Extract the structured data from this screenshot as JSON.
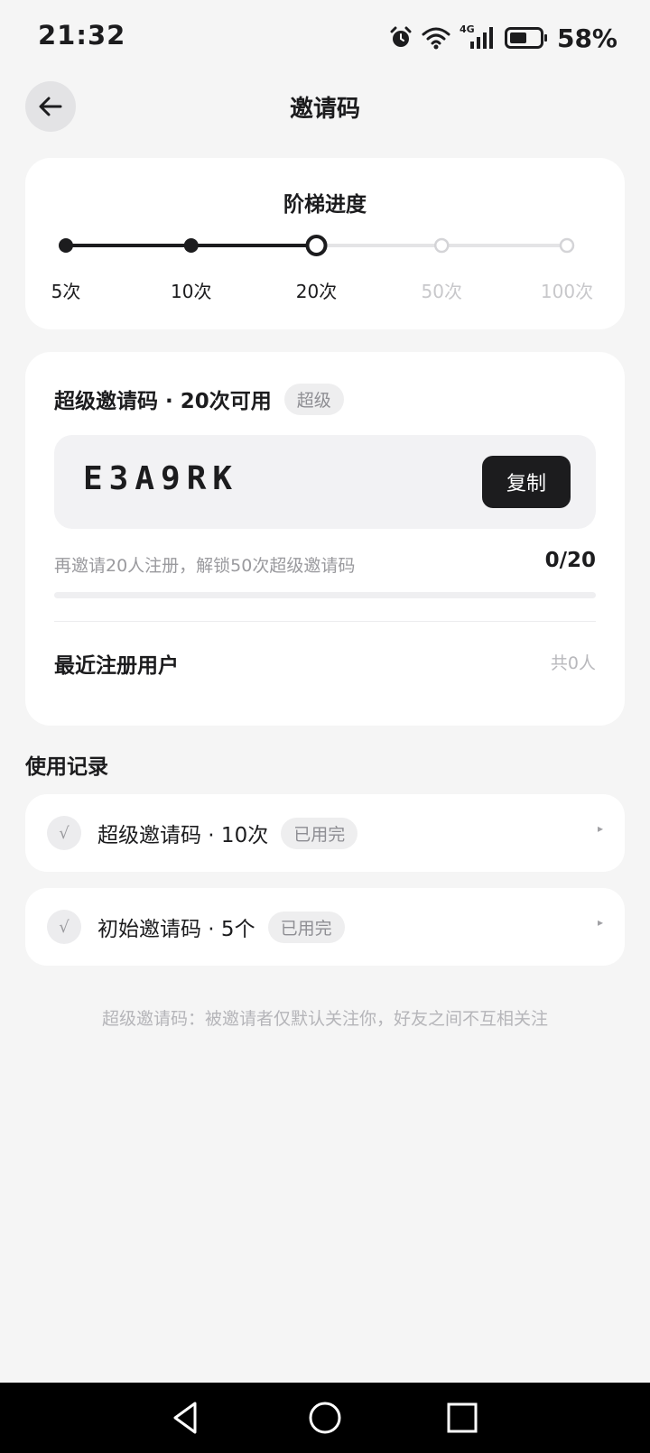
{
  "status_bar": {
    "time": "21:32",
    "network": "4G",
    "battery_percent": "58%",
    "battery_level": 0.58
  },
  "header": {
    "title": "邀请码",
    "back_icon": "arrow-left-icon"
  },
  "ladder": {
    "title": "阶梯进度",
    "steps": [
      {
        "label": "5次",
        "state": "done"
      },
      {
        "label": "10次",
        "state": "done"
      },
      {
        "label": "20次",
        "state": "current"
      },
      {
        "label": "50次",
        "state": "todo"
      },
      {
        "label": "100次",
        "state": "todo"
      }
    ]
  },
  "code_card": {
    "title": "超级邀请码 · 20次可用",
    "badge": "超级",
    "code": "E3A9RK",
    "copy_label": "复制",
    "unlock_text": "再邀请20人注册，解锁50次超级邀请码",
    "unlock_count": "0/20",
    "unlock_progress": 0,
    "recent_title": "最近注册用户",
    "recent_count": "共0人"
  },
  "records": {
    "title": "使用记录",
    "items": [
      {
        "title": "超级邀请码 · 10次",
        "status": "已用完",
        "check": "√"
      },
      {
        "title": "初始邀请码 · 5个",
        "status": "已用完",
        "check": "√"
      }
    ],
    "arrow_glyph": "▸"
  },
  "footnote": "超级邀请码：被邀请者仅默认关注你，好友之间不互相关注",
  "colors": {
    "accent": "#1c1c1e",
    "background": "#f5f5f5",
    "muted": "#c8c8cb"
  }
}
